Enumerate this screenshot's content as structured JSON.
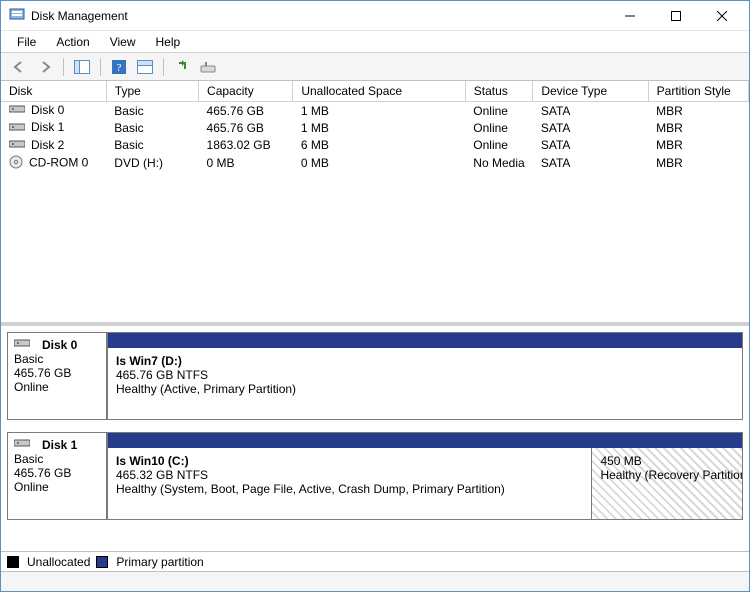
{
  "window": {
    "title": "Disk Management"
  },
  "menu": {
    "file": "File",
    "action": "Action",
    "view": "View",
    "help": "Help"
  },
  "columns": {
    "disk": "Disk",
    "type": "Type",
    "capacity": "Capacity",
    "unallocated": "Unallocated Space",
    "status": "Status",
    "device_type": "Device Type",
    "partition_style": "Partition Style"
  },
  "disks": [
    {
      "name": "Disk 0",
      "type": "Basic",
      "capacity": "465.76 GB",
      "unallocated": "1 MB",
      "status": "Online",
      "device_type": "SATA",
      "partition_style": "MBR",
      "iskind": "hdd"
    },
    {
      "name": "Disk 1",
      "type": "Basic",
      "capacity": "465.76 GB",
      "unallocated": "1 MB",
      "status": "Online",
      "device_type": "SATA",
      "partition_style": "MBR",
      "iskind": "hdd"
    },
    {
      "name": "Disk 2",
      "type": "Basic",
      "capacity": "1863.02 GB",
      "unallocated": "6 MB",
      "status": "Online",
      "device_type": "SATA",
      "partition_style": "MBR",
      "iskind": "hdd"
    },
    {
      "name": "CD-ROM 0",
      "type": "DVD (H:)",
      "capacity": "0 MB",
      "unallocated": "0 MB",
      "status": "No Media",
      "device_type": "SATA",
      "partition_style": "MBR",
      "iskind": "cd"
    }
  ],
  "graphic": [
    {
      "label": "Disk 0",
      "type": "Basic",
      "capacity": "465.76 GB",
      "status": "Online",
      "partitions": [
        {
          "name": "Is Win7  (D:)",
          "size": "465.76 GB NTFS",
          "health": "Healthy (Active, Primary Partition)",
          "flex": 1,
          "hatched": false
        }
      ]
    },
    {
      "label": "Disk 1",
      "type": "Basic",
      "capacity": "465.76 GB",
      "status": "Online",
      "partitions": [
        {
          "name": "Is Win10  (C:)",
          "size": "465.32 GB NTFS",
          "health": "Healthy (System, Boot, Page File, Active, Crash Dump, Primary Partition)",
          "flex": 7,
          "hatched": false
        },
        {
          "name": "",
          "size": "450 MB",
          "health": "Healthy (Recovery Partition)",
          "flex": 2,
          "hatched": true
        }
      ]
    }
  ],
  "legend": {
    "unallocated": "Unallocated",
    "primary": "Primary partition"
  }
}
